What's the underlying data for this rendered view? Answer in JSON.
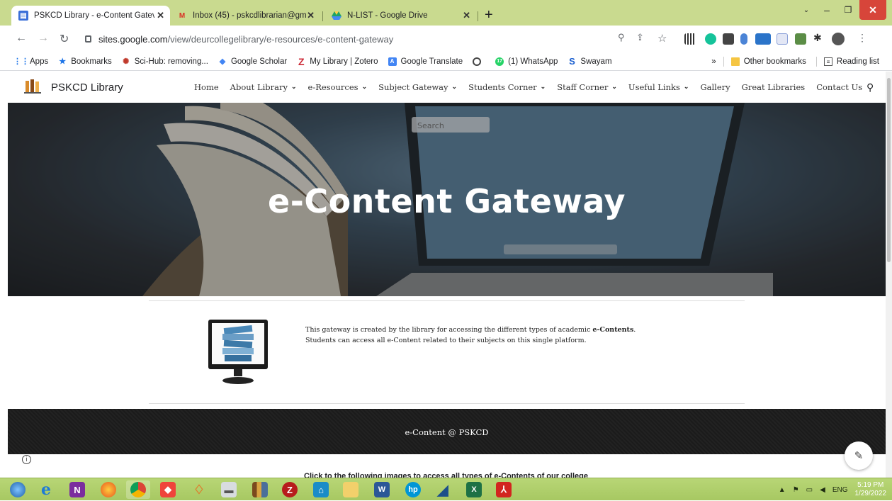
{
  "browser": {
    "tabs": [
      {
        "title": "PSKCD Library - e-Content Gatev",
        "active": true,
        "favicon": "google-sites-icon"
      },
      {
        "title": "Inbox (45) - pskcdlibrarian@gma",
        "active": false,
        "favicon": "gmail-icon"
      },
      {
        "title": "N-LIST - Google Drive",
        "active": false,
        "favicon": "google-drive-icon"
      }
    ],
    "new_tab": "+",
    "address": {
      "host": "sites.google.com",
      "path": "/view/deurcollegelibrary/e-resources/e-content-gateway"
    },
    "bookmarks": [
      {
        "label": "Apps",
        "icon": "apps-grid-icon"
      },
      {
        "label": "Bookmarks",
        "icon": "star-icon"
      },
      {
        "label": "Sci-Hub: removing...",
        "icon": "scihub-icon"
      },
      {
        "label": "Google Scholar",
        "icon": "scholar-icon"
      },
      {
        "label": "My Library | Zotero",
        "icon": "zotero-icon"
      },
      {
        "label": "Google Translate",
        "icon": "translate-icon"
      },
      {
        "label": "",
        "icon": "globe-icon"
      },
      {
        "label": "(1) WhatsApp",
        "icon": "whatsapp-icon"
      },
      {
        "label": "Swayam",
        "icon": "swayam-icon"
      }
    ],
    "bookmarks_more": "»",
    "other_bookmarks": "Other bookmarks",
    "reading_list": "Reading list"
  },
  "site": {
    "title": "PSKCD Library",
    "nav": [
      {
        "label": "Home",
        "dropdown": false
      },
      {
        "label": "About Library",
        "dropdown": true
      },
      {
        "label": "e-Resources",
        "dropdown": true
      },
      {
        "label": "Subject Gateway",
        "dropdown": true
      },
      {
        "label": "Students Corner",
        "dropdown": true
      },
      {
        "label": "Staff Corner",
        "dropdown": true
      },
      {
        "label": "Useful Links",
        "dropdown": true
      },
      {
        "label": "Gallery",
        "dropdown": false
      },
      {
        "label": "Great Libraries",
        "dropdown": false
      },
      {
        "label": "Contact Us",
        "dropdown": false
      }
    ],
    "hero_title": "e-Content Gateway",
    "hero_search_placeholder": "Search",
    "intro_line1_prefix": "This gateway is created by the library for accessing the different types of academic ",
    "intro_line1_bold": "e-Contents",
    "intro_line1_suffix": ".",
    "intro_line2": "Students can access all e-Content related to their subjects on this single platform.",
    "band_text": "e-Content @ PSKCD",
    "cut_text": "Click to the following images to access all types of e-Contents of our college"
  },
  "taskbar": {
    "apps": [
      "start-orb-icon",
      "internet-explorer-icon",
      "onenote-icon",
      "firefox-icon",
      "chrome-icon",
      "anydesk-icon",
      "origin-icon",
      "printer-icon",
      "library-icon",
      "zotero-app-icon",
      "security-icon",
      "file-explorer-icon",
      "word-icon",
      "hp-icon",
      "ruler-icon",
      "excel-icon",
      "acrobat-icon"
    ],
    "language": "ENG",
    "time": "5:19 PM",
    "date": "1/29/2022"
  },
  "colors": {
    "tabstrip": "#c9da8f",
    "taskbar": "#a7c862",
    "band": "#1b1b1b",
    "window_close": "#d7453a"
  }
}
